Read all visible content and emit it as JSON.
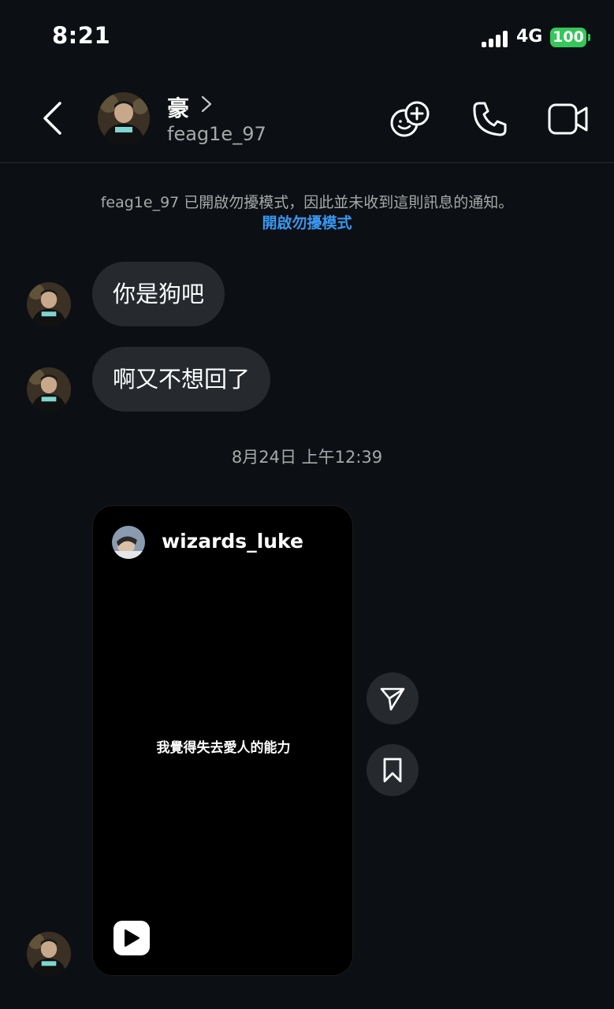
{
  "status_bar": {
    "time": "8:21",
    "network": "4G",
    "battery": "100"
  },
  "header": {
    "contact_name": "豪",
    "username": "feag1e_97",
    "icons": [
      "back-icon",
      "effects-icon",
      "phone-icon",
      "video-icon"
    ]
  },
  "notice": {
    "text": "feag1e_97 已開啟勿擾模式，因此並未收到這則訊息的通知。",
    "link": "開啟勿擾模式"
  },
  "messages": [
    {
      "text": "你是狗吧"
    },
    {
      "text": "啊又不想回了"
    }
  ],
  "timestamp": "8月24日 上午12:39",
  "shared_reel": {
    "username": "wizards_luke",
    "caption": "我覺得失去愛人的能力"
  },
  "colors": {
    "background": "#0c1014",
    "bubble": "#262a2f",
    "link": "#3897f0",
    "battery": "#34c759"
  }
}
